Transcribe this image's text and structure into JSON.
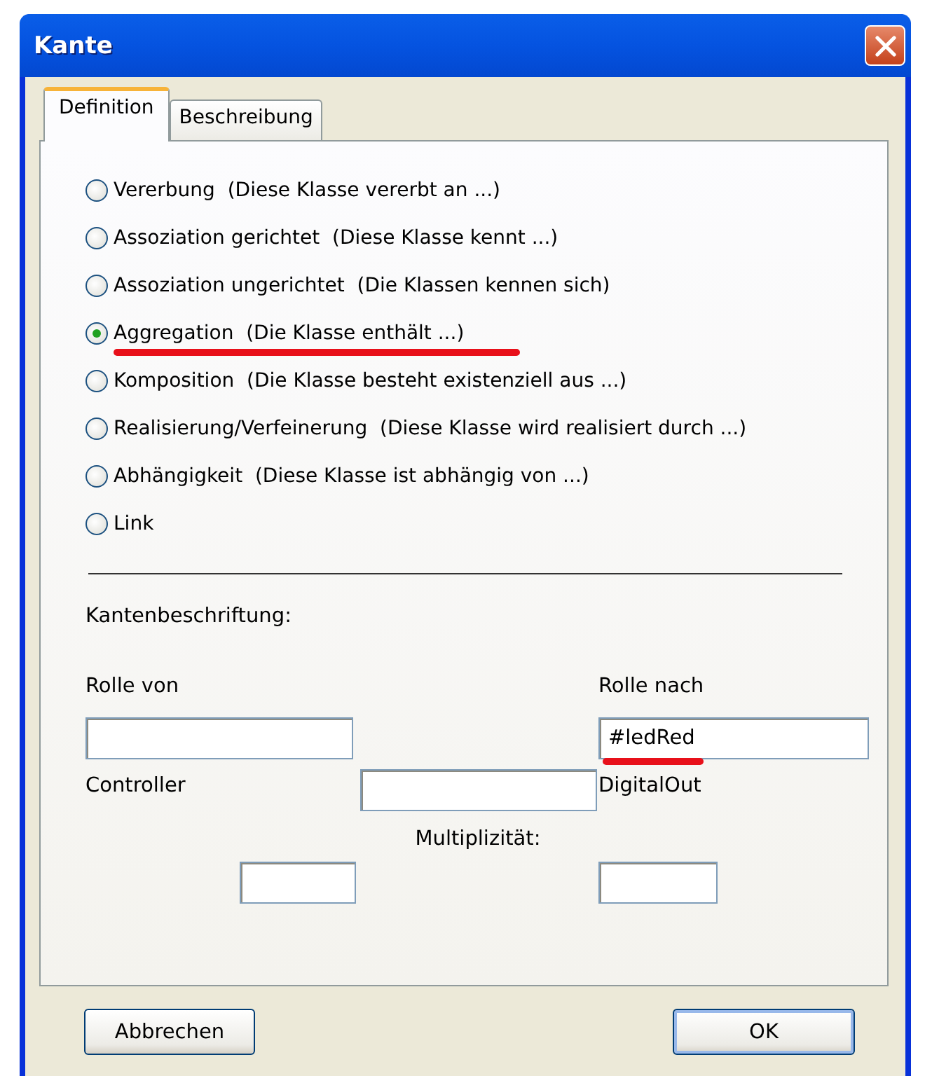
{
  "window": {
    "title": "Kante"
  },
  "tabs": [
    {
      "label": "Definition",
      "selected": true
    },
    {
      "label": "Beschreibung",
      "selected": false
    }
  ],
  "edge_types": [
    {
      "label": "Vererbung  (Diese Klasse vererbt an ...)",
      "selected": false,
      "annotated": false
    },
    {
      "label": "Assoziation gerichtet  (Diese Klasse kennt ...)",
      "selected": false,
      "annotated": false
    },
    {
      "label": "Assoziation ungerichtet  (Die Klassen kennen sich)",
      "selected": false,
      "annotated": false
    },
    {
      "label": "Aggregation  (Die Klasse enthält ...)",
      "selected": true,
      "annotated": true
    },
    {
      "label": "Komposition  (Die Klasse besteht existenziell aus ...)",
      "selected": false,
      "annotated": false
    },
    {
      "label": "Realisierung/Verfeinerung  (Diese Klasse wird realisiert durch ...)",
      "selected": false,
      "annotated": false
    },
    {
      "label": "Abhängigkeit  (Diese Klasse ist abhängig von ...)",
      "selected": false,
      "annotated": false
    },
    {
      "label": "Link",
      "selected": false,
      "annotated": false
    }
  ],
  "edge_label": {
    "heading": "Kantenbeschriftung:",
    "role_from": {
      "label": "Rolle von",
      "annotated": false
    },
    "role_to": {
      "label": "Rolle nach",
      "value": "#ledRed",
      "annotated": true
    },
    "source_class": "Controller",
    "target_class": "DigitalOut",
    "multiplicity": {
      "label": "Multiplizität:"
    }
  },
  "buttons": [
    {
      "label": "Abbrechen",
      "default": false
    },
    {
      "label": "OK",
      "default": true
    }
  ]
}
